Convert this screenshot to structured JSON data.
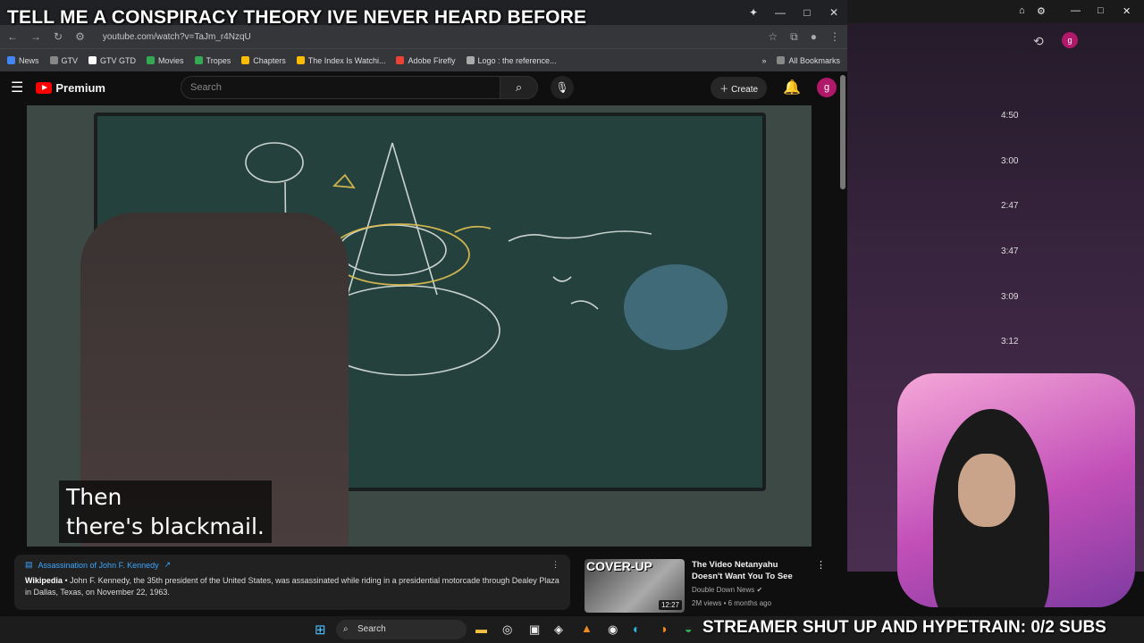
{
  "overlay_title": "TELL ME A CONSPIRACY THEORY IVE NEVER HEARD BEFORE",
  "address": {
    "url": "youtube.com/watch?v=TaJm_r4NzqU"
  },
  "bookmarks": [
    {
      "label": "News",
      "color": "#4285f4"
    },
    {
      "label": "GTV",
      "color": "#888888"
    },
    {
      "label": "GTV GTD",
      "color": "#ffffff"
    },
    {
      "label": "Movies",
      "color": "#34a853"
    },
    {
      "label": "Tropes",
      "color": "#34a853"
    },
    {
      "label": "Chapters",
      "color": "#fbbc05"
    },
    {
      "label": "The Index Is Watchi...",
      "color": "#fbbc05"
    },
    {
      "label": "Adobe Firefly",
      "color": "#ea4335"
    },
    {
      "label": "Logo : the reference...",
      "color": "#aaaaaa"
    }
  ],
  "bookmarks_right": "All Bookmarks",
  "youtube": {
    "brand": "Premium",
    "search_placeholder": "Search",
    "create_label": "Create",
    "avatar_letter": "g"
  },
  "video": {
    "subtitle_line1": "Then",
    "subtitle_line2": "there's blackmail."
  },
  "info_panel": {
    "title": "Assassination of John F. Kennedy",
    "source": "Wikipedia",
    "body": "John F. Kennedy, the 35th president of the United States, was assassinated while riding in a presidential motorcade through Dealey Plaza in Dallas, Texas, on November 22, 1963."
  },
  "recommendation": {
    "thumb_text": "COVER-UP",
    "duration": "12:27",
    "title": "The Video Netanyahu Doesn't Want You To See",
    "channel": "Double Down News",
    "meta": "2M views • 6 months ago"
  },
  "side_times": [
    "4:50",
    "3:00",
    "2:47",
    "3:47",
    "3:09",
    "3:12"
  ],
  "taskbar": {
    "search_label": "Search"
  },
  "ticker": "STREAMER SHUT UP AND HYPETRAIN: 0/2 SUBS"
}
